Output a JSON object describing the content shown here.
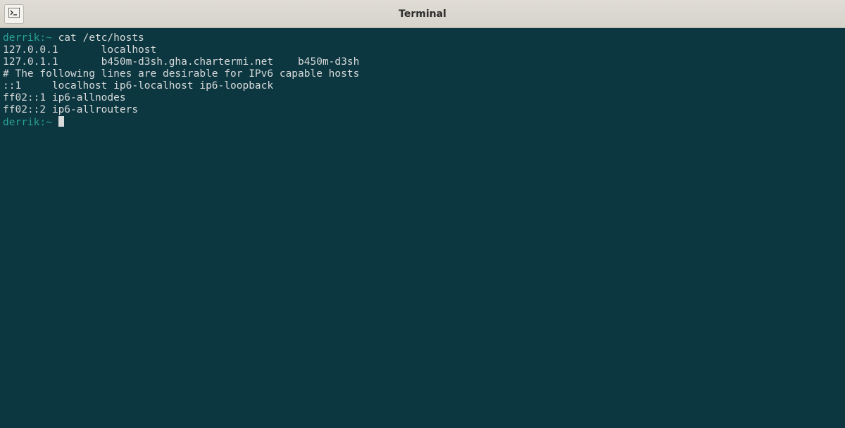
{
  "titlebar": {
    "title": "Terminal"
  },
  "terminal": {
    "prompt1": "derrik:~",
    "command1": " cat /etc/hosts",
    "line1": "127.0.0.1       localhost",
    "line2": "127.0.1.1       b450m-d3sh.gha.chartermi.net    b450m-d3sh",
    "blank1": "",
    "comment1": "# The following lines are desirable for IPv6 capable hosts",
    "line3": "::1     localhost ip6-localhost ip6-loopback",
    "line4": "ff02::1 ip6-allnodes",
    "line5": "ff02::2 ip6-allrouters",
    "prompt2": "derrik:~",
    "trailing_space": " "
  }
}
